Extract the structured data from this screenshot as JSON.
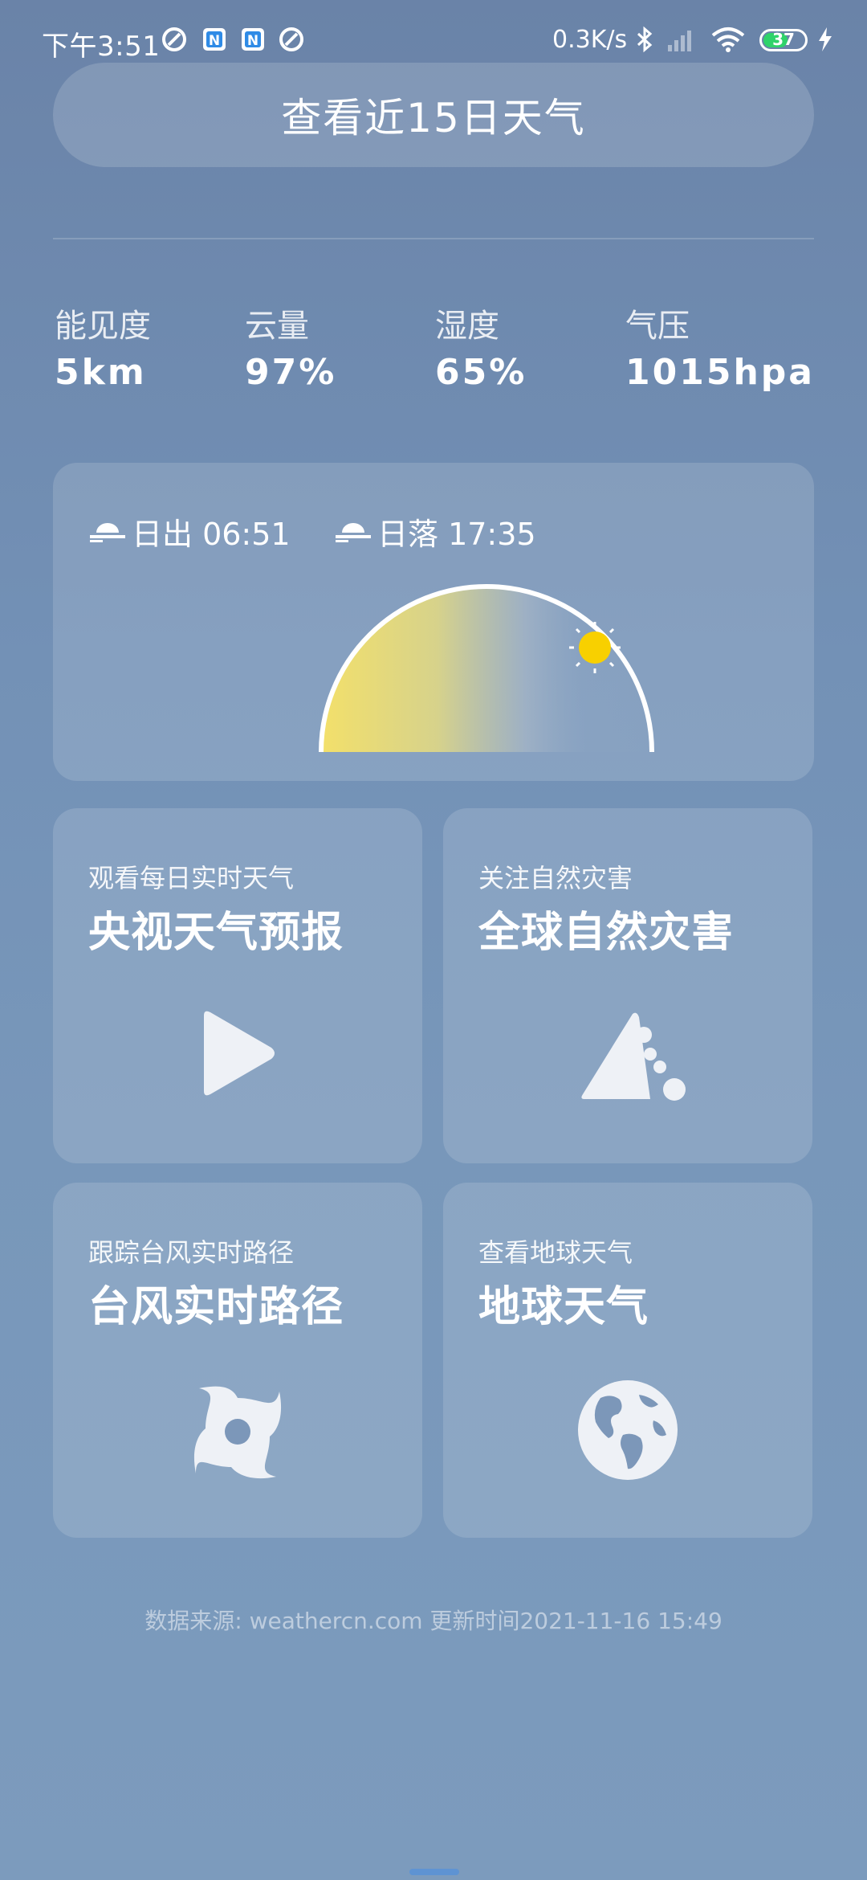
{
  "status_bar": {
    "time": "下午3:51",
    "network_speed": "0.3K/s",
    "battery": "37",
    "icons": [
      "vpn-icon",
      "app-n-icon",
      "app-n-icon",
      "vpn-icon",
      "bluetooth-icon",
      "signal-icon",
      "wifi-icon",
      "battery-icon",
      "charging-icon"
    ]
  },
  "forecast_button": {
    "label": "查看近15日天气"
  },
  "metrics": [
    {
      "label": "能见度",
      "value": "5km"
    },
    {
      "label": "云量",
      "value": "97%"
    },
    {
      "label": "湿度",
      "value": "65%"
    },
    {
      "label": "气压",
      "value": "1015hpa"
    }
  ],
  "sun": {
    "sunrise": "日出 06:51",
    "sunset": "日落 17:35",
    "arc_color_start": "#f3e06a",
    "sun_color": "#f8d000"
  },
  "cards": [
    {
      "subtitle": "观看每日实时天气",
      "title": "央视天气预报",
      "icon": "play-icon"
    },
    {
      "subtitle": "关注自然灾害",
      "title": "全球自然灾害",
      "icon": "landslide-icon"
    },
    {
      "subtitle": "跟踪台风实时路径",
      "title": "台风实时路径",
      "icon": "typhoon-icon"
    },
    {
      "subtitle": "查看地球天气",
      "title": "地球天气",
      "icon": "globe-icon"
    }
  ],
  "footer": {
    "text": "数据来源: weathercn.com 更新时间2021-11-16 15:49"
  }
}
